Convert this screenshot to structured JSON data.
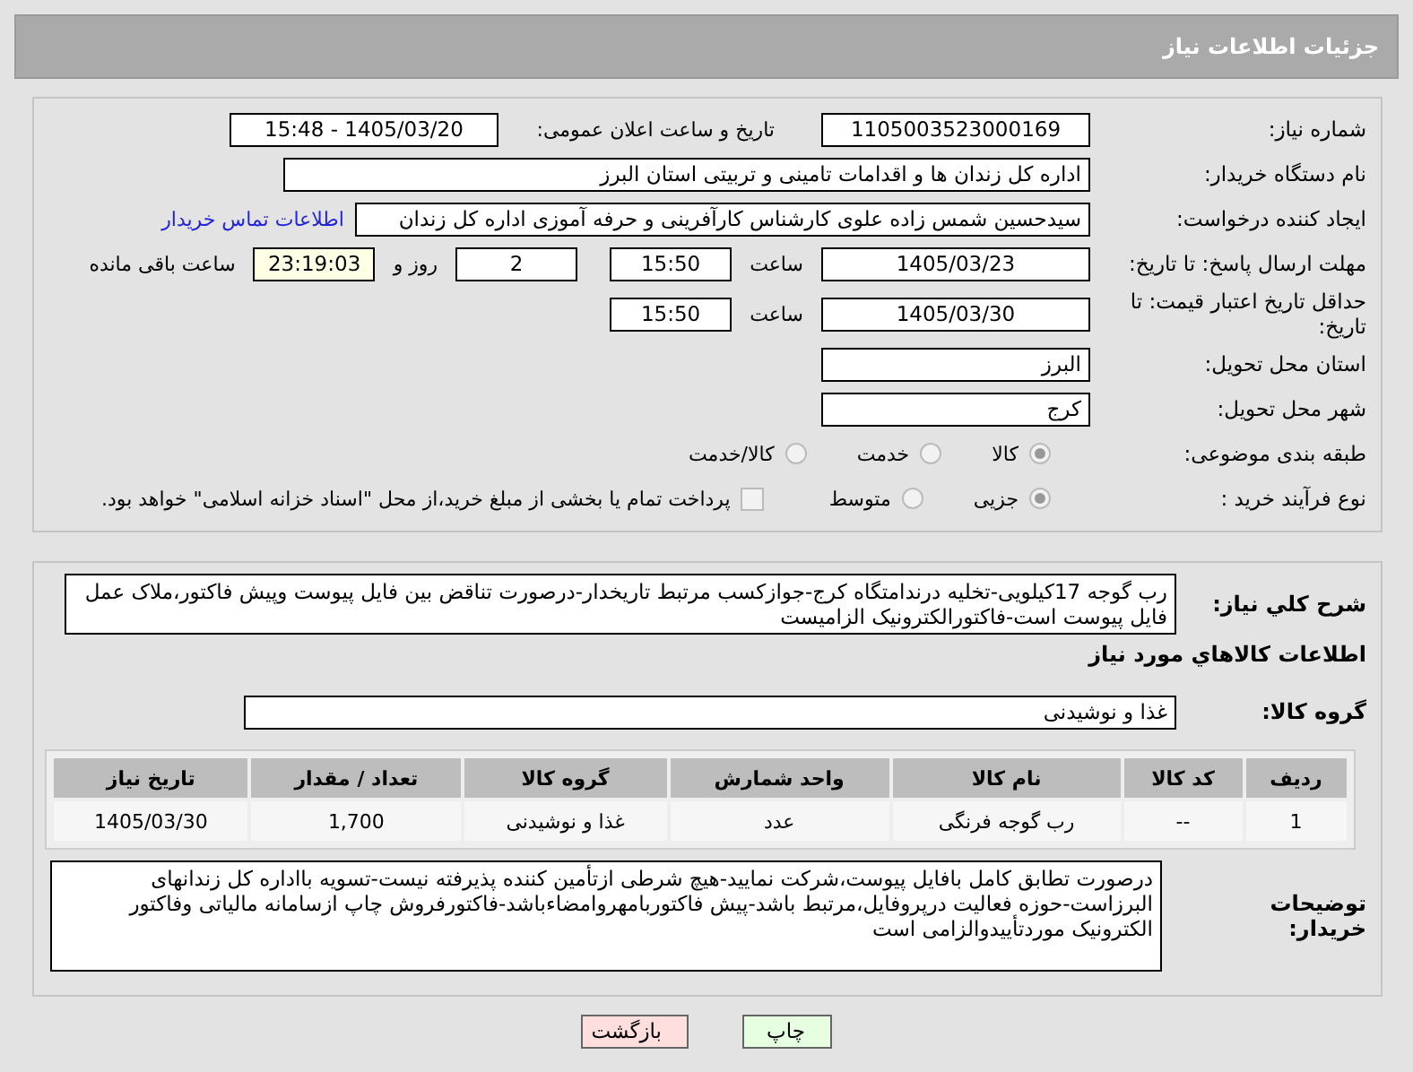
{
  "header": {
    "title": "جزئیات اطلاعات نیاز"
  },
  "need_number": {
    "label": "شماره نیاز:",
    "value": "1105003523000169"
  },
  "announce": {
    "label": "تاریخ و ساعت اعلان عمومی:",
    "value": "1405/03/20 - 15:48"
  },
  "buyer_org": {
    "label": "نام دستگاه خریدار:",
    "value": "اداره کل زندان ها و اقدامات تامینی و تربیتی استان البرز"
  },
  "creator": {
    "label": "ایجاد کننده درخواست:",
    "value": "سیدحسین شمس زاده علوی کارشناس کارآفرینی و حرفه آموزی اداره کل زندان",
    "link": "اطلاعات تماس خریدار"
  },
  "deadline": {
    "label": "مهلت ارسال پاسخ: تا تاریخ:",
    "date": "1405/03/23",
    "time_label": "ساعت",
    "time": "15:50",
    "days": "2",
    "days_label": "روز و",
    "remaining": "23:19:03",
    "remaining_label": "ساعت باقی مانده"
  },
  "validity": {
    "label": "حداقل تاریخ اعتبار قیمت: تا تاریخ:",
    "date": "1405/03/30",
    "time_label": "ساعت",
    "time": "15:50"
  },
  "province": {
    "label": "استان محل تحویل:",
    "value": "البرز"
  },
  "city": {
    "label": "شهر محل تحویل:",
    "value": "کرج"
  },
  "category": {
    "label": "طبقه بندی موضوعی:",
    "options": [
      {
        "label": "کالا",
        "selected": true
      },
      {
        "label": "خدمت",
        "selected": false
      },
      {
        "label": "کالا/خدمت",
        "selected": false
      }
    ]
  },
  "process": {
    "label": "نوع فرآیند خرید :",
    "options": [
      {
        "label": "جزیی",
        "selected": true
      },
      {
        "label": "متوسط",
        "selected": false
      }
    ],
    "payment_checkbox": {
      "label": "پرداخت تمام یا بخشی از مبلغ خرید،از محل \"اسناد خزانه اسلامی\" خواهد بود.",
      "checked": false
    }
  },
  "description": {
    "label": "شرح کلي نياز:",
    "value": "رب گوجه 17کیلویی-تخلیه درندامتگاه کرج-جوازکسب مرتبط تاریخدار-درصورت تناقض بین فایل پیوست وپیش فاکتور،ملاک عمل فایل پیوست است-فاکتورالکترونیک الزامیست"
  },
  "goods_heading": "اطلاعات کالاهاي مورد نياز",
  "goods_group": {
    "label": "گروه کالا:",
    "value": "غذا و نوشیدنی"
  },
  "table": {
    "columns": [
      "ردیف",
      "کد کالا",
      "نام کالا",
      "واحد شمارش",
      "گروه کالا",
      "تعداد / مقدار",
      "تاریخ نیاز"
    ],
    "rows": [
      [
        "1",
        "--",
        "رب گوجه فرنگی",
        "عدد",
        "غذا و نوشیدنی",
        "1,700",
        "1405/03/30"
      ]
    ]
  },
  "buyer_notes": {
    "label": "توضیحات خریدار:",
    "value": "درصورت تطابق کامل بافایل پیوست،شرکت نمایید-هیچ شرطی ازتأمین کننده پذیرفته نیست-تسویه بااداره کل زندانهای البرزاست-حوزه فعالیت درپروفایل،مرتبط باشد-پیش فاکتوربامهروامضاءباشد-فاکتورفروش چاپ ازسامانه مالیاتی وفاکتور الکترونیک موردتأییدوالزامی است"
  },
  "buttons": [
    {
      "label": "چاپ",
      "kind": "print"
    },
    {
      "label": "بازگشت",
      "kind": "back"
    }
  ]
}
